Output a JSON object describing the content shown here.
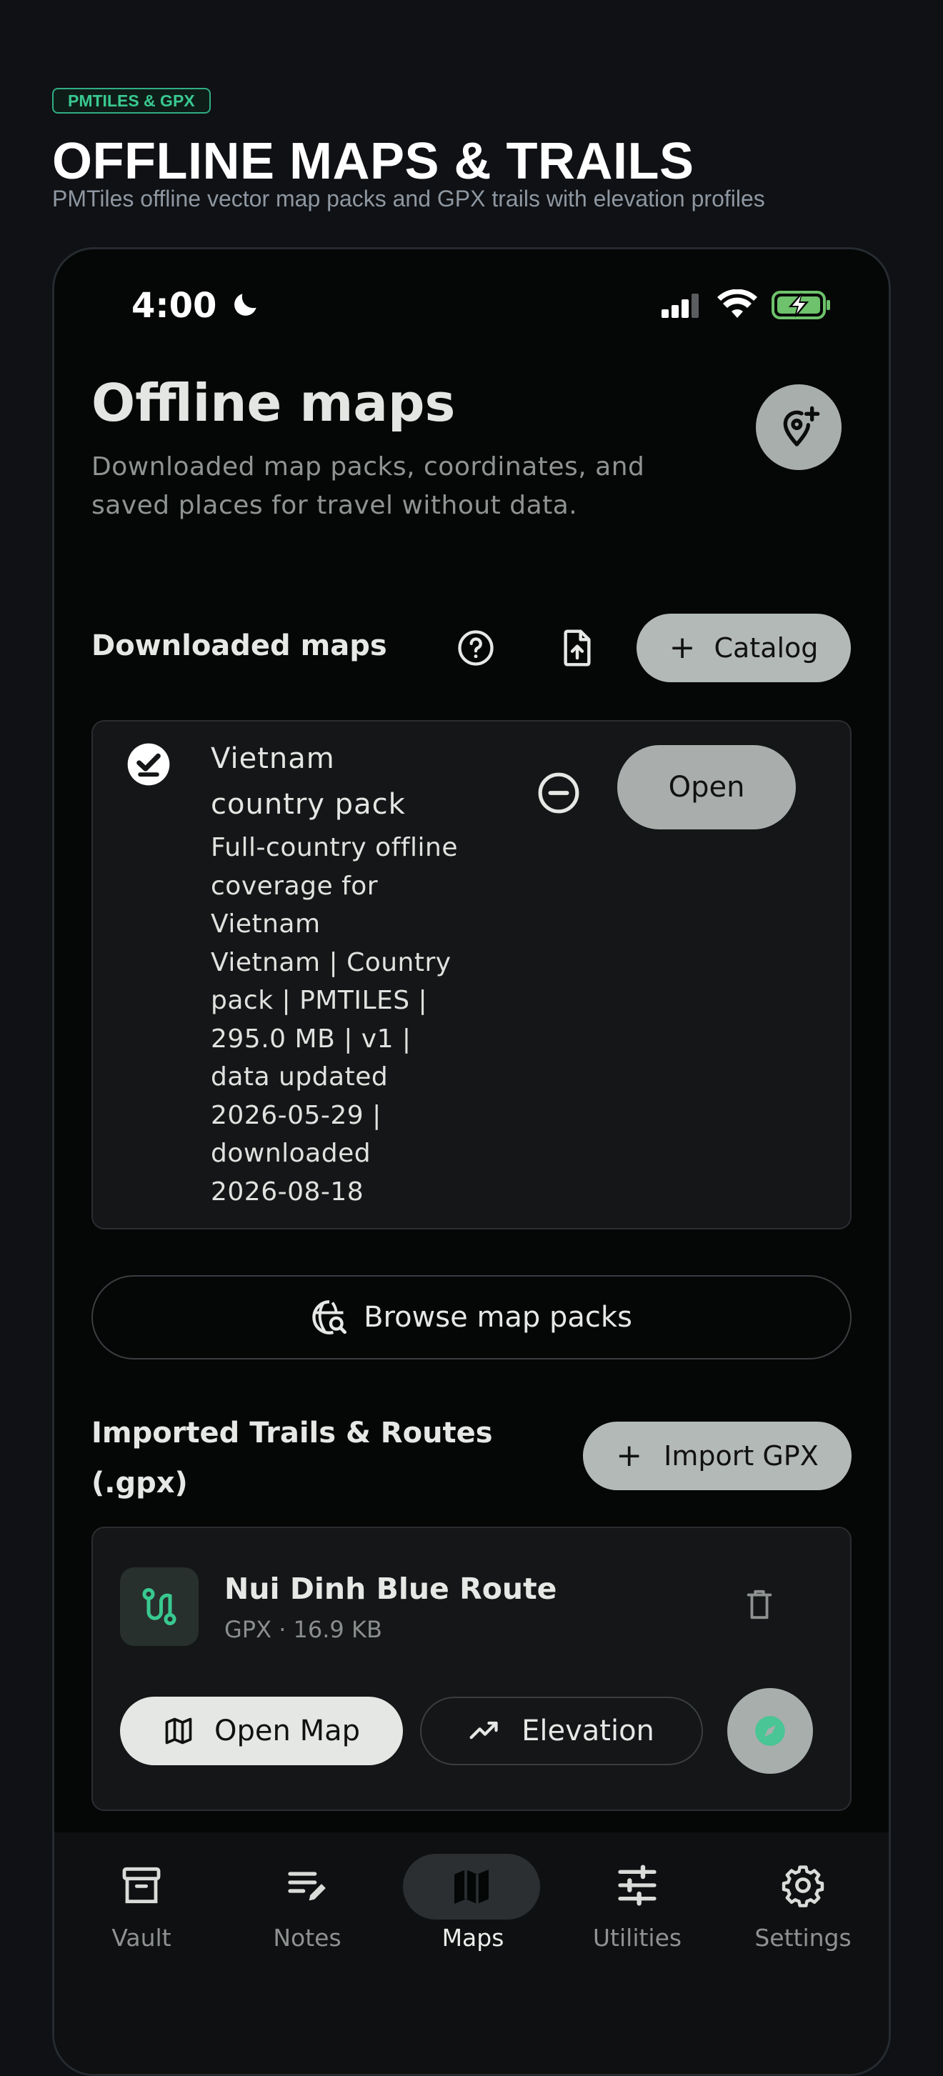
{
  "header": {
    "badge": "PMTILES & GPX",
    "title": "OFFLINE MAPS & TRAILS",
    "subtitle": "PMTiles offline vector map packs and GPX trails with elevation profiles"
  },
  "status_bar": {
    "time": "4:00"
  },
  "page": {
    "title": "Offline maps",
    "subtitle": "Downloaded map packs, coordinates, and saved places for travel without data."
  },
  "downloaded": {
    "section_title": "Downloaded maps",
    "catalog_label": "Catalog",
    "packs": [
      {
        "title_line1": "Vietnam",
        "title_line2": "country pack",
        "desc_lines": [
          "Full-country offline",
          "coverage for",
          "Vietnam",
          "Vietnam | Country",
          "pack | PMTILES |",
          "295.0 MB | v1 |",
          "data updated",
          "2026-05-29 |",
          "downloaded",
          "2026-08-18"
        ],
        "open_label": "Open"
      }
    ],
    "browse_label": "Browse map packs"
  },
  "trails": {
    "section_title_line1": "Imported Trails & Routes",
    "section_title_line2": "(.gpx)",
    "import_label": "Import GPX",
    "items": [
      {
        "name": "Nui Dinh Blue Route",
        "meta": "GPX · 16.9 KB",
        "open_map_label": "Open Map",
        "elevation_label": "Elevation"
      }
    ]
  },
  "bottom_nav": {
    "items": [
      {
        "label": "Vault",
        "icon": "archive-icon",
        "active": false
      },
      {
        "label": "Notes",
        "icon": "notes-icon",
        "active": false
      },
      {
        "label": "Maps",
        "icon": "map-icon",
        "active": true
      },
      {
        "label": "Utilities",
        "icon": "sliders-icon",
        "active": false
      },
      {
        "label": "Settings",
        "icon": "gear-icon",
        "active": false
      }
    ]
  },
  "colors": {
    "accent": "#39c990",
    "background": "#050606",
    "button_fill": "#b3b9b6"
  }
}
